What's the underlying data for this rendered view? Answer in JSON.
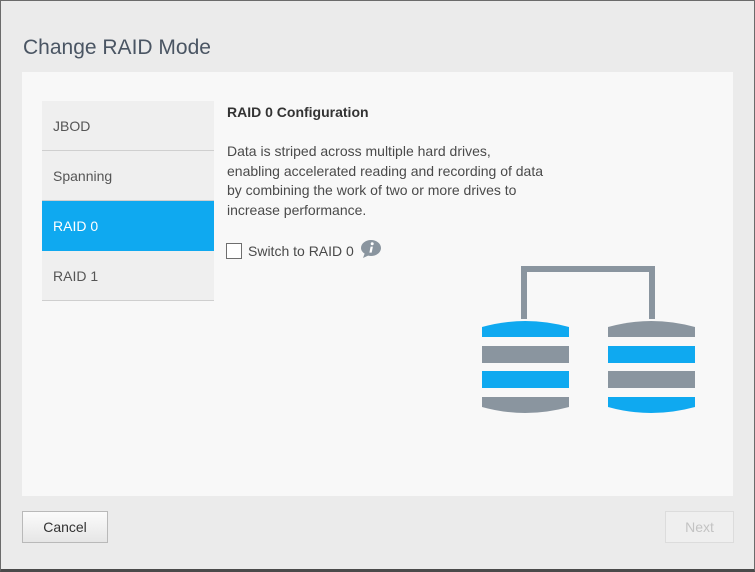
{
  "dialog": {
    "title": "Change RAID Mode"
  },
  "modes": [
    {
      "label": "JBOD",
      "selected": false
    },
    {
      "label": "Spanning",
      "selected": false
    },
    {
      "label": "RAID 0",
      "selected": true
    },
    {
      "label": "RAID 1",
      "selected": false
    }
  ],
  "detail": {
    "title": "RAID 0 Configuration",
    "description": "Data is striped across multiple hard drives, enabling accelerated reading and recording of data by combining the work of two or more drives to increase performance.",
    "switch_label": "Switch to RAID 0",
    "switch_checked": false,
    "info_icon": "info-icon"
  },
  "buttons": {
    "cancel": "Cancel",
    "next": "Next",
    "next_enabled": false
  },
  "colors": {
    "accent": "#0fa9f0",
    "drive_gray": "#8a959f",
    "connector": "#8a959f"
  }
}
